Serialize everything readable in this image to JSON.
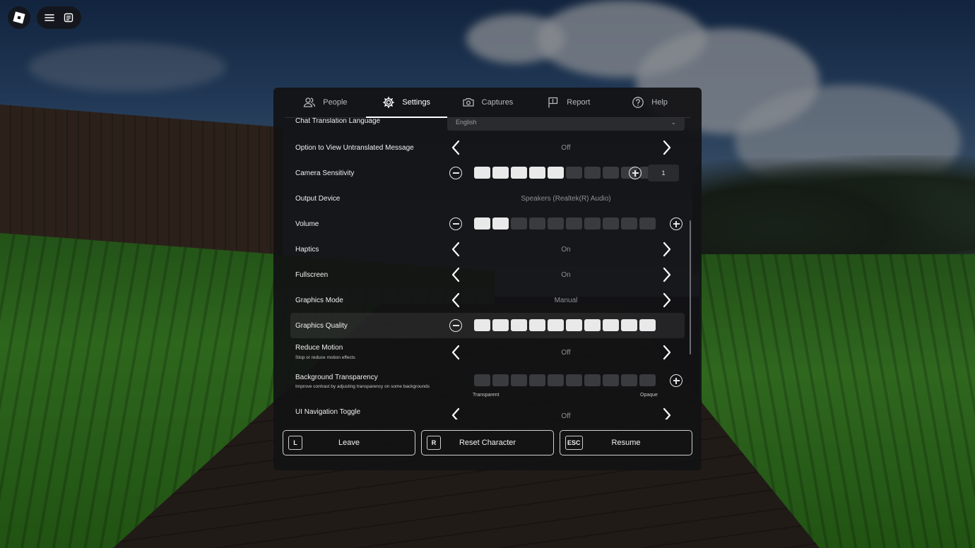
{
  "top_controls": {
    "roblox_icon": "roblox-logo-icon",
    "menu_icon": "hamburger-menu-icon",
    "chat_icon": "chat-icon"
  },
  "tabs": [
    {
      "label": "People",
      "icon": "people-icon",
      "active": false
    },
    {
      "label": "Settings",
      "icon": "gear-icon",
      "active": true
    },
    {
      "label": "Captures",
      "icon": "camera-icon",
      "active": false
    },
    {
      "label": "Report",
      "icon": "flag-icon",
      "active": false
    },
    {
      "label": "Help",
      "icon": "help-icon",
      "active": false
    }
  ],
  "settings": {
    "chat_translation": {
      "label": "Chat Translation Language",
      "value": "English"
    },
    "untranslated": {
      "label": "Option to View Untranslated Message",
      "value": "Off"
    },
    "camera_sensitivity": {
      "label": "Camera Sensitivity",
      "level": 5,
      "segments": 10,
      "value": "1"
    },
    "output_device": {
      "label": "Output Device",
      "value": "Speakers (Realtek(R) Audio)"
    },
    "volume": {
      "label": "Volume",
      "level": 2,
      "segments": 10
    },
    "haptics": {
      "label": "Haptics",
      "value": "On"
    },
    "fullscreen": {
      "label": "Fullscreen",
      "value": "On"
    },
    "graphics_mode": {
      "label": "Graphics Mode",
      "value": "Manual"
    },
    "graphics_quality": {
      "label": "Graphics Quality",
      "level": 10,
      "segments": 10
    },
    "reduce_motion": {
      "label": "Reduce Motion",
      "sub": "Stop or reduce motion effects",
      "value": "Off"
    },
    "bg_transparency": {
      "label": "Background Transparency",
      "sub": "Improve contrast by adjusting transparency on some backgrounds",
      "level": 0,
      "segments": 10,
      "min_label": "Transparent",
      "max_label": "Opaque"
    },
    "ui_nav_toggle": {
      "label": "UI Navigation Toggle",
      "value": "Off"
    }
  },
  "footer": {
    "leave": {
      "key": "L",
      "label": "Leave"
    },
    "reset": {
      "key": "R",
      "label": "Reset Character"
    },
    "resume": {
      "key": "ESC",
      "label": "Resume"
    }
  }
}
